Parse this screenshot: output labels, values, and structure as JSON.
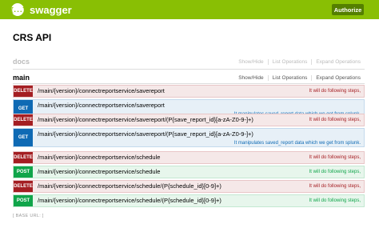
{
  "topbar": {
    "logo_icon_text": "{...}",
    "logo_text": "swagger",
    "authorize_label": "Authorize"
  },
  "api_title": "CRS API",
  "sections": {
    "docs": {
      "name": "docs",
      "links": [
        "Show/Hide",
        "List Operations",
        "Expand Operations"
      ]
    },
    "main": {
      "name": "main",
      "links": [
        "Show/Hide",
        "List Operations",
        "Expand Operations"
      ]
    }
  },
  "operations": [
    {
      "method": "DELETE",
      "path": "/main/{version}/connectreportservice/savereport",
      "summary": "It will do following steps,"
    },
    {
      "method": "GET",
      "path": "/main/{version}/connectreportservice/savereport",
      "summary": "It manipulates saved_report data which we get from splunk."
    },
    {
      "method": "DELETE",
      "path": "/main/{version}/connectreportservice/savereport/(P{save_report_id}[a-zA-Z0-9-]+)",
      "summary": "It will do following steps,"
    },
    {
      "method": "GET",
      "path": "/main/{version}/connectreportservice/savereport/(P{save_report_id}[a-zA-Z0-9-]+)",
      "summary": "It manipulates saved_report data which we get from splunk."
    },
    {
      "method": "DELETE",
      "path": "/main/{version}/connectreportservice/schedule",
      "summary": "It will do following steps,"
    },
    {
      "method": "POST",
      "path": "/main/{version}/connectreportservice/schedule",
      "summary": "It will do following steps,"
    },
    {
      "method": "DELETE",
      "path": "/main/{version}/connectreportservice/schedule/(P{schedule_id}[0-9]+)",
      "summary": "It will do following steps,"
    },
    {
      "method": "POST",
      "path": "/main/{version}/connectreportservice/schedule/(P{schedule_id}[0-9]+)",
      "summary": "It will do following steps,"
    }
  ],
  "base_url": "[ BASE URL: ]",
  "colors": {
    "topbar": "#89bf04",
    "authorize": "#547f00",
    "delete": "#a41e22",
    "get": "#0f6ab4",
    "post": "#10a54a"
  }
}
